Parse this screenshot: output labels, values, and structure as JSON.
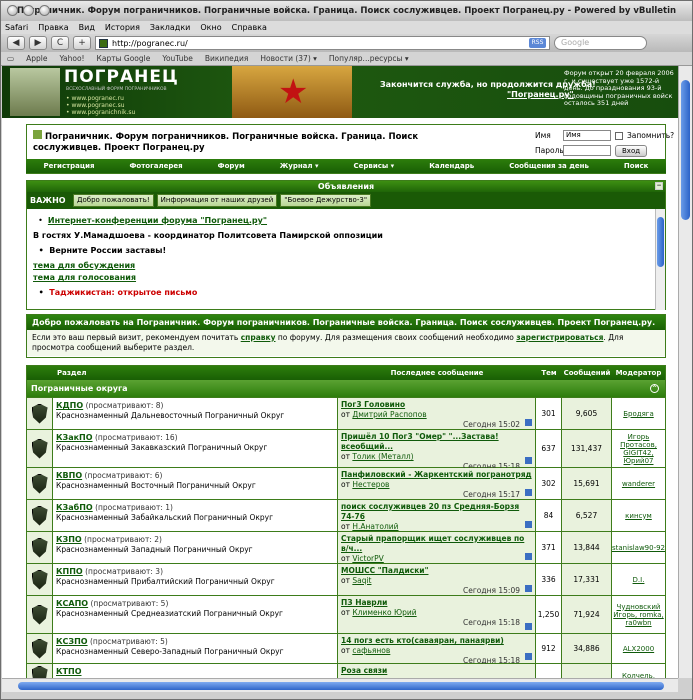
{
  "window": {
    "title": "Пограничник. Форум пограничников. Пограничные войска. Граница. Поиск сослуживцев. Проект Погранец.ру - Powered by vBulletin"
  },
  "menubar": [
    "Safari",
    "Правка",
    "Вид",
    "История",
    "Закладки",
    "Окно",
    "Справка"
  ],
  "toolbar": {
    "back": "◀",
    "forward": "▶",
    "reload": "C",
    "add": "+",
    "url": "http://pogranec.ru/",
    "rss": "RSS",
    "search_placeholder": "Google"
  },
  "bookmarks": [
    "Apple",
    "Yahoo!",
    "Карты Google",
    "YouTube",
    "Википедия",
    "Новости (37) ▾",
    "Популяр...ресурсы ▾"
  ],
  "banner": {
    "logo": "ПОГРАНЕЦ",
    "logo_sub": "ВСЕХОСЛАВНЫЙ ФОРУМ ПОГРАНИЧНИКОВ",
    "links": [
      "• www.pogranec.ru",
      "• www.pogranec.su",
      "• www.pogranichnik.su"
    ],
    "slogan": "Закончится служба, но продолжится дружба!",
    "slogan_link": "\"Погранец.ру\"",
    "info": "Форум открыт 20 февраля 2006 г. и существует уже 1572-й день. До празднования 93-й годовщины пограничных войск осталось 351 дней"
  },
  "header": {
    "title": "Пограничник. Форум пограничников. Пограничные войска. Граница. Поиск сослуживцев. Проект Погранец.ру",
    "login": {
      "name_label": "Имя",
      "name_value": "Имя",
      "remember": "Запомнить?",
      "pass_label": "Пароль",
      "enter": "Вход"
    }
  },
  "nav": [
    "Регистрация",
    "Фотогалерея",
    "Форум",
    "Журнал ▾",
    "Сервисы ▾",
    "Календарь",
    "Сообщения за день",
    "Поиск"
  ],
  "announcements": {
    "title": "Объявления",
    "tabs": [
      "ВАЖНО",
      "Добро пожаловать!",
      "Информация от наших друзей",
      "\"Боевое Дежурство-3\""
    ],
    "line1": "Интернет-конференции форума \"Погранец.ру\"",
    "line2": "В гостях У.Мамадшоева - координатор Политсовета Памирской оппозиции",
    "line3": "Верните России заставы!",
    "line4": "тема для обсуждения",
    "line5": "тема для голосования",
    "line6": "Таджикистан: открытое письмо"
  },
  "welcome": {
    "title": "Добро пожаловать на Пограничник. Форум пограничников. Пограничные войска. Граница. Поиск сослуживцев. Проект Погранец.ру.",
    "text1": "Если это ваш первый визит, рекомендуем почитать ",
    "link1": "справку",
    "text2": " по форуму. Для размещения своих сообщений необходимо ",
    "link2": "зарегистрироваться",
    "text3": ". Для просмотра сообщений выберите раздел."
  },
  "table": {
    "cols": [
      "Раздел",
      "Последнее сообщение",
      "Тем",
      "Сообщений",
      "Модератор"
    ],
    "category": "Пограничные округа",
    "rows": [
      {
        "name": "КДПО",
        "view": "(просматривают: 8)",
        "desc": "Краснознаменный Дальневосточный Пограничный Округ",
        "last_title": "Пог3 Головино",
        "last_by": "Дмитрий Распопов",
        "last_date": "Сегодня 15:02",
        "threads": "301",
        "posts": "9,605",
        "mod": "Бродяга"
      },
      {
        "name": "КЗакПО",
        "view": "(просматривают: 16)",
        "desc": "Краснознаменный Закавказский Пограничный Округ",
        "last_title": "Пришёл 10 Пог3 \"Омер\" \"...Застава! всеобщий...",
        "last_by": "Толик (Металл)",
        "last_date": "Сегодня 15:18",
        "threads": "637",
        "posts": "131,437",
        "mod": "Игорь Протасов, GIGIT42, Юрий07"
      },
      {
        "name": "КВПО",
        "view": "(просматривают: 6)",
        "desc": "Краснознаменный Восточный Пограничный Округ",
        "last_title": "Панфиловский - Жаркентский погранотряд",
        "last_by": "Нестеров",
        "last_date": "Сегодня 15:17",
        "threads": "302",
        "posts": "15,691",
        "mod": "wanderer"
      },
      {
        "name": "КЗабПО",
        "view": "(просматривают: 1)",
        "desc": "Краснознаменный Забайкальский Пограничный Округ",
        "last_title": "поиск сослуживцев 20 пз Средняя-Борзя 74-76",
        "last_by": "Н.Анатолий",
        "last_date": "Сегодня 10:41",
        "threads": "84",
        "posts": "6,527",
        "mod": "кинсум"
      },
      {
        "name": "КЗПО",
        "view": "(просматривают: 2)",
        "desc": "Краснознаменный Западный Пограничный Округ",
        "last_title": "Старый прапорщик ищет сослуживцев по в/ч...",
        "last_by": "VictorPV",
        "last_date": "Сегодня 10:42",
        "threads": "371",
        "posts": "13,844",
        "mod": "stanislaw90-92"
      },
      {
        "name": "КППО",
        "view": "(просматривают: 3)",
        "desc": "Краснознаменный Прибалтийский Пограничный Округ",
        "last_title": "МОШСС \"Палдиски\"",
        "last_by": "Saqit",
        "last_date": "Сегодня 15:09",
        "threads": "336",
        "posts": "17,331",
        "mod": "D.I."
      },
      {
        "name": "КСАПО",
        "view": "(просматривают: 5)",
        "desc": "Краснознаменный Среднеазиатский Пограничный Округ",
        "last_title": "ПЗ Наврли",
        "last_by": "Клименко Юрий",
        "last_date": "Сегодня 15:18",
        "threads": "1,250",
        "posts": "71,924",
        "mod": "Чудновский Игорь, romka, ra0wbn"
      },
      {
        "name": "КСЗПО",
        "view": "(просматривают: 5)",
        "desc": "Краснознаменный Северо-Западный Пограничный Округ",
        "last_title": "14 погз есть кто(саваяран, панаярви)",
        "last_by": "сафьянов",
        "last_date": "Сегодня 15:18",
        "threads": "912",
        "posts": "34,886",
        "mod": "ALX2000"
      },
      {
        "name": "КТПО",
        "view": "",
        "desc": "",
        "last_title": "Роза связи",
        "last_by": "",
        "last_date": "",
        "threads": "",
        "posts": "",
        "mod": "Колчель,"
      }
    ]
  }
}
